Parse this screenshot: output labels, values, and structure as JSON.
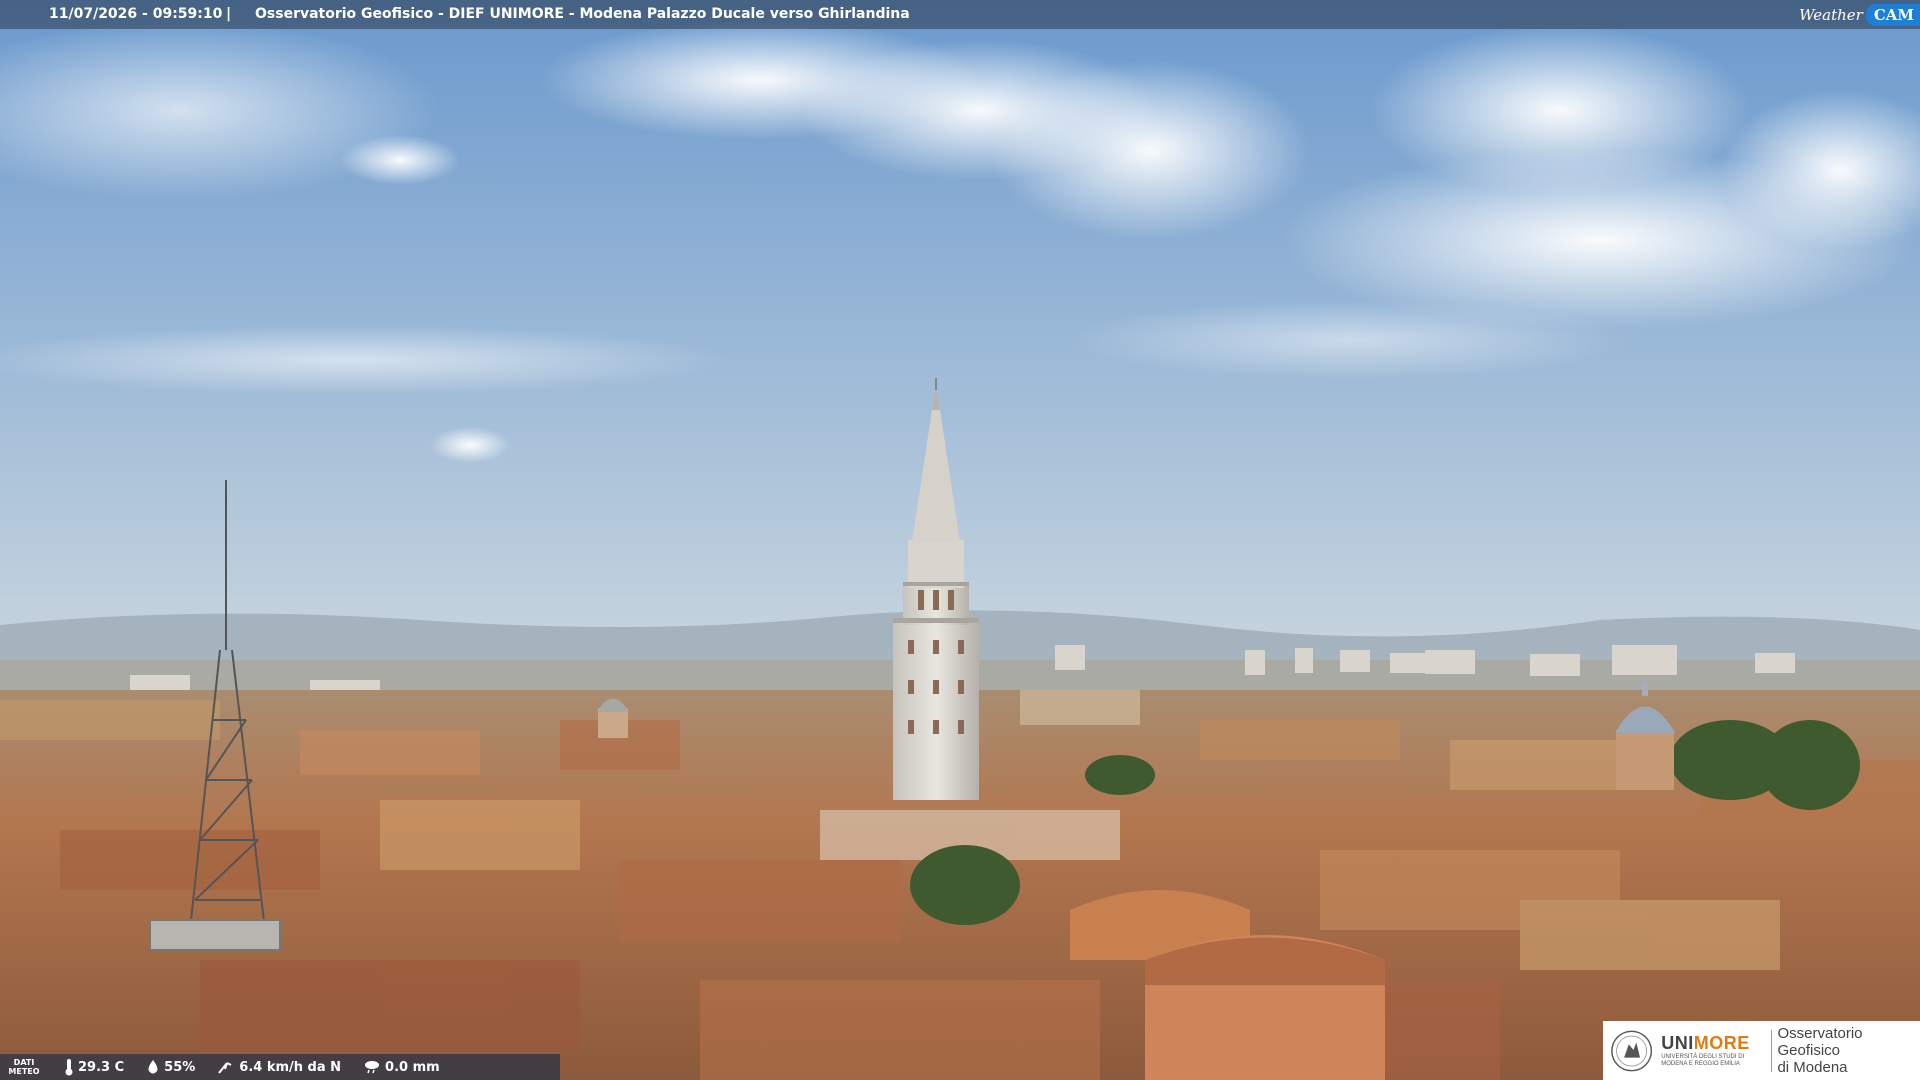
{
  "header": {
    "datetime": "11/07/2026 - 09:59:10",
    "separator": "|",
    "caption": "Osservatorio Geofisico - DIEF UNIMORE - Modena Palazzo Ducale verso Ghirlandina",
    "brand_part1": "Weather",
    "brand_part2": "CAM"
  },
  "meteo": {
    "label_line1": "DATI",
    "label_line2": "METEO",
    "temperature": "29.3 C",
    "humidity": "55%",
    "wind": "6.4 km/h da N",
    "rain": "0.0 mm"
  },
  "logo": {
    "uni_prefix": "UNI",
    "uni_suffix": "MORE",
    "uni_sub_line1": "UNIVERSITÀ DEGLI STUDI DI",
    "uni_sub_line2": "MODENA E REGGIO EMILIA",
    "obs_line1": "Osservatorio Geofisico",
    "obs_line2": "di Modena"
  },
  "colors": {
    "sky_top": "#6f9ccf",
    "sky_bottom": "#c9d6e0",
    "roofs": "#b0704a",
    "brand_blue": "#1e7fd6",
    "unimore_orange": "#e07b16"
  }
}
